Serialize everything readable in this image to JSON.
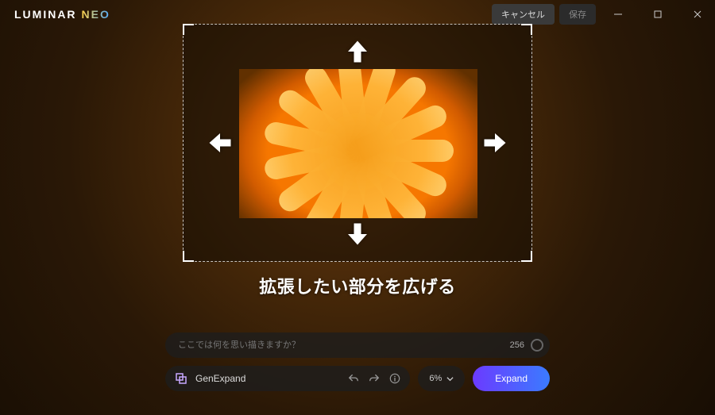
{
  "brand": {
    "a": "LUMINAR",
    "b": "NEO"
  },
  "titlebar": {
    "cancel": "キャンセル",
    "save": "保存"
  },
  "instruction": "拡張したい部分を広げる",
  "prompt": {
    "placeholder": "ここでは何を思い描きますか？",
    "counter": "256"
  },
  "tool": {
    "icon": "genexpand-icon",
    "name": "GenExpand",
    "zoom": "6%",
    "expand": "Expand"
  }
}
